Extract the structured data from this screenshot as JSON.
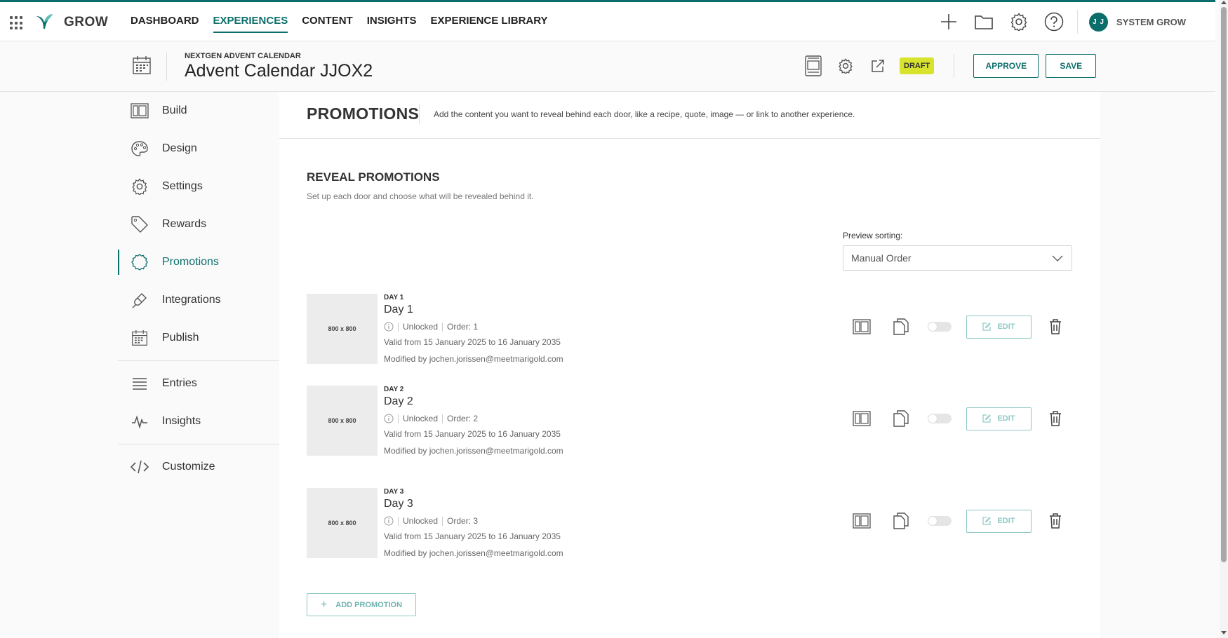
{
  "topbar": {
    "brand": "GROW",
    "nav": [
      "DASHBOARD",
      "EXPERIENCES",
      "CONTENT",
      "INSIGHTS",
      "EXPERIENCE LIBRARY"
    ],
    "active_nav": "EXPERIENCES",
    "user_initials": "J J",
    "user_name": "SYSTEM GROW"
  },
  "header": {
    "overline": "NEXTGEN ADVENT CALENDAR",
    "title": "Advent Calendar JJOX2",
    "status": "DRAFT",
    "approve_label": "APPROVE",
    "save_label": "SAVE"
  },
  "sidebar": {
    "items": [
      {
        "label": "Build",
        "icon": "layout-icon"
      },
      {
        "label": "Design",
        "icon": "palette-icon"
      },
      {
        "label": "Settings",
        "icon": "gear-icon"
      },
      {
        "label": "Rewards",
        "icon": "tag-icon"
      },
      {
        "label": "Promotions",
        "icon": "badge-icon"
      },
      {
        "label": "Integrations",
        "icon": "plug-icon"
      },
      {
        "label": "Publish",
        "icon": "calendar-icon"
      },
      {
        "label": "Entries",
        "icon": "list-icon"
      },
      {
        "label": "Insights",
        "icon": "pulse-icon"
      },
      {
        "label": "Customize",
        "icon": "code-icon"
      }
    ],
    "active": "Promotions"
  },
  "main": {
    "section_title": "PROMOTIONS",
    "section_desc": "Add the content you want to reveal behind each door, like a recipe, quote, image — or link to another experience.",
    "reveal_title": "REVEAL PROMOTIONS",
    "reveal_desc": "Set up each door and choose what will be revealed behind it.",
    "sort_label": "Preview sorting:",
    "sort_value": "Manual Order",
    "edit_label": "EDIT",
    "add_label": "ADD PROMOTION",
    "promotions": [
      {
        "thumb": "800 x 800",
        "overline": "DAY 1",
        "title": "Day 1",
        "state": "Unlocked",
        "order": "Order: 1",
        "valid": "Valid from 15 January 2025 to 16 January 2035",
        "modified": "Modified by jochen.jorissen@meetmarigold.com"
      },
      {
        "thumb": "800 x 800",
        "overline": "DAY 2",
        "title": "Day 2",
        "state": "Unlocked",
        "order": "Order: 2",
        "valid": "Valid from 15 January 2025 to 16 January 2035",
        "modified": "Modified by jochen.jorissen@meetmarigold.com"
      },
      {
        "thumb": "800 x 800",
        "overline": "DAY 3",
        "title": "Day 3",
        "state": "Unlocked",
        "order": "Order: 3",
        "valid": "Valid from 15 January 2025 to 16 January 2035",
        "modified": "Modified by jochen.jorissen@meetmarigold.com"
      }
    ]
  },
  "colors": {
    "accent": "#0b6e6a",
    "draft": "#d7e32c",
    "edit_border": "#8fc9c5"
  }
}
